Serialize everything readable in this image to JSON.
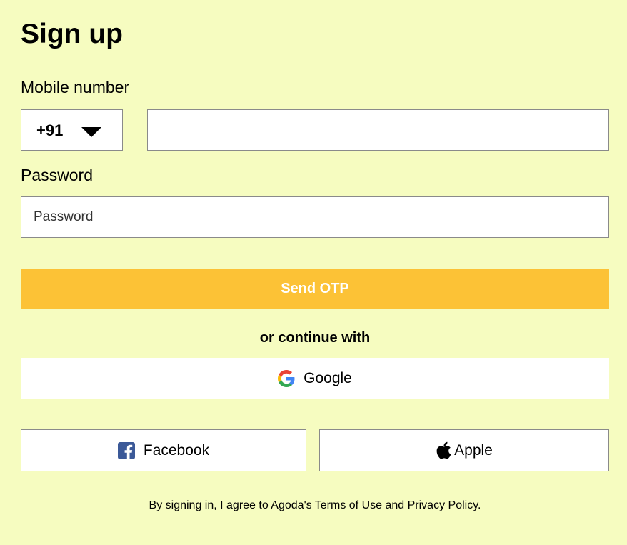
{
  "title": "Sign up",
  "mobile": {
    "label": "Mobile number",
    "country_code": "+91",
    "value": "",
    "placeholder": ""
  },
  "password": {
    "label": "Password",
    "value": "",
    "placeholder": "Password"
  },
  "send_otp": {
    "label": "Send OTP"
  },
  "divider": "or continue with",
  "social": {
    "google": {
      "label": "Google",
      "icon": "google-icon"
    },
    "facebook": {
      "label": "Facebook",
      "icon": "facebook-icon"
    },
    "apple": {
      "label": "Apple",
      "icon": "apple-icon"
    }
  },
  "legal": {
    "prefix": "By signing in, I agree to Agoda's ",
    "terms": "Terms of Use",
    "and": " and ",
    "privacy": "Privacy Policy",
    "suffix": "."
  },
  "colors": {
    "background": "#f6fcc0",
    "primary_button": "#fcc236",
    "facebook_blue": "#3b5998"
  }
}
